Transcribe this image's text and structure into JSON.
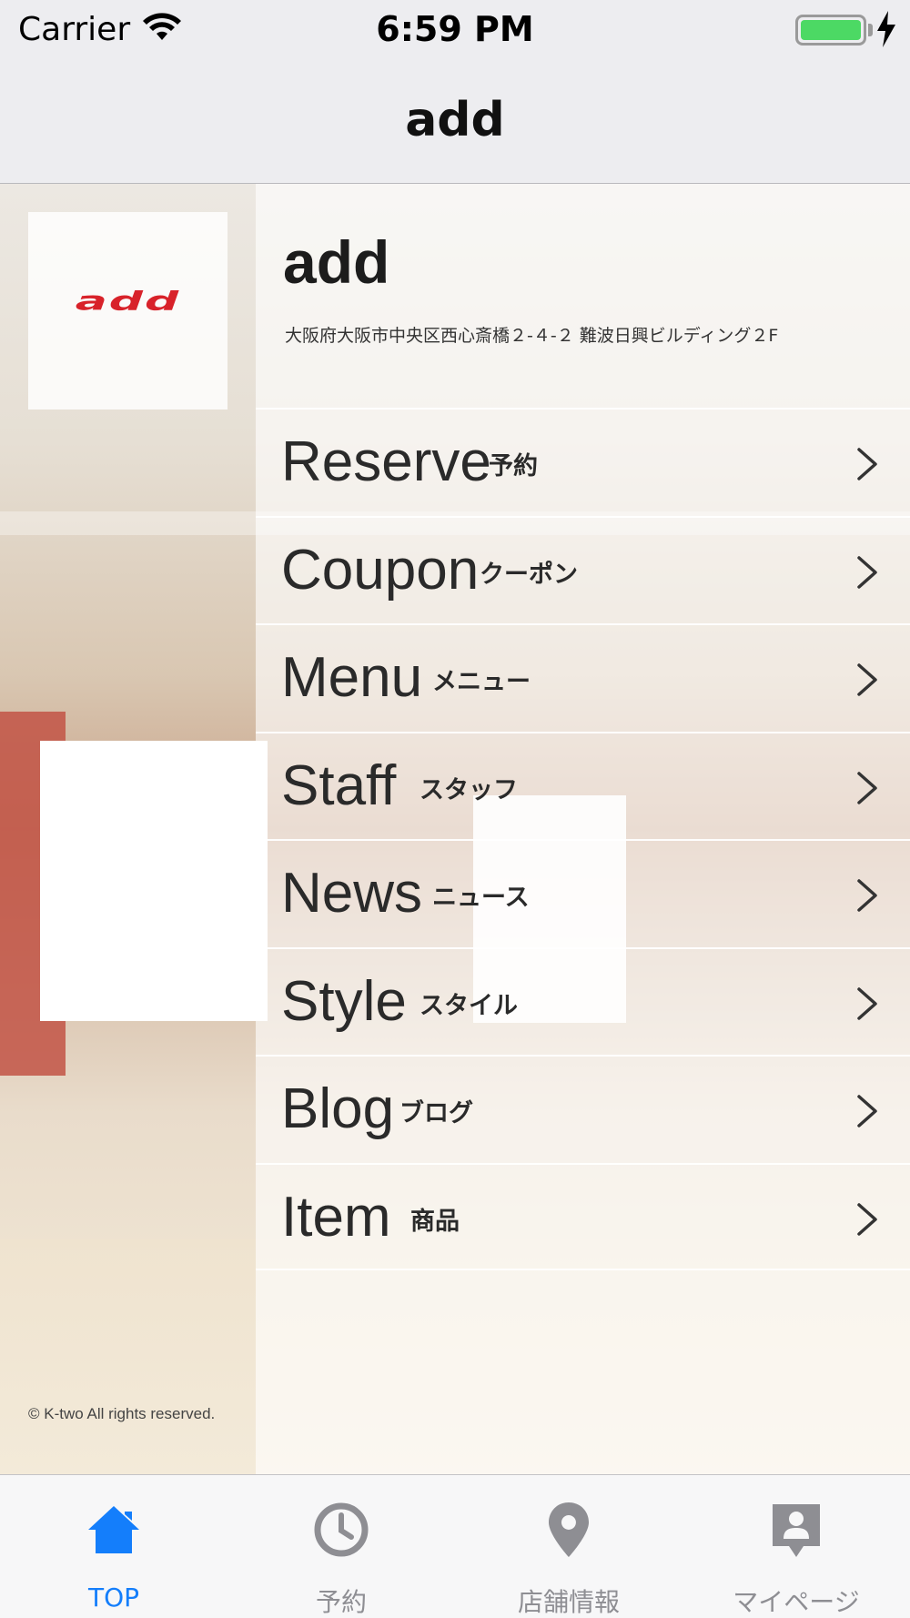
{
  "status_bar": {
    "carrier": "Carrier",
    "time": "6:59 PM",
    "battery_color": "#4cd964"
  },
  "nav_bar": {
    "title": "add"
  },
  "sidebar": {
    "logo_text": "add",
    "logo_color": "#d8222a",
    "copyright": "© K-two All rights reserved."
  },
  "shop": {
    "name": "add",
    "address": "大阪府大阪市中央区西心斎橋２-４-２ 難波日興ビルディング２F"
  },
  "menu": [
    {
      "en": "Reserve",
      "jp": "予約"
    },
    {
      "en": "Coupon",
      "jp": "クーポン"
    },
    {
      "en": "Menu",
      "jp": "メニュー"
    },
    {
      "en": "Staff",
      "jp": "スタッフ"
    },
    {
      "en": "News",
      "jp": "ニュース"
    },
    {
      "en": "Style",
      "jp": "スタイル"
    },
    {
      "en": "Blog",
      "jp": "ブログ"
    },
    {
      "en": "Item",
      "jp": "商品"
    }
  ],
  "tab_bar": {
    "active_color": "#147efb",
    "inactive_color": "#8e8e93",
    "tabs": [
      {
        "label": "TOP",
        "icon": "home-icon"
      },
      {
        "label": "予約",
        "icon": "clock-icon"
      },
      {
        "label": "店舗情報",
        "icon": "location-pin-icon"
      },
      {
        "label": "マイページ",
        "icon": "profile-icon"
      }
    ]
  }
}
